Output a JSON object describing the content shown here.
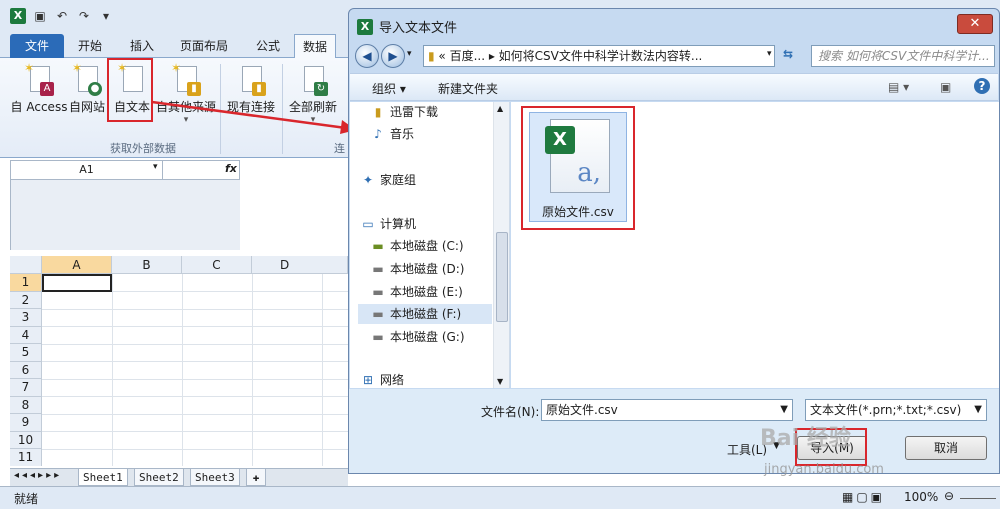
{
  "excel": {
    "qat_icons": [
      "save-icon",
      "undo-icon",
      "redo-icon"
    ],
    "tabs": [
      "文件",
      "开始",
      "插入",
      "页面布局",
      "公式",
      "数据"
    ],
    "ribbon_buttons": [
      "自 Access",
      "自网站",
      "自文本",
      "自其他来源",
      "现有连接",
      "全部刷新"
    ],
    "group_label": "获取外部数据",
    "group_label_cut": "连",
    "namebox": "A1",
    "fx": "fx",
    "columns": [
      "A",
      "B",
      "C",
      "D"
    ],
    "rows": [
      "1",
      "2",
      "3",
      "4",
      "5",
      "6",
      "7",
      "8",
      "9",
      "10",
      "11"
    ],
    "sheets": [
      "Sheet1",
      "Sheet2",
      "Sheet3"
    ],
    "status": "就绪",
    "zoom": "100%",
    "accent": "#2b6bb8"
  },
  "dialog": {
    "title": "导入文本文件",
    "close": "✕",
    "address": "« 百度... ▸ 如何将CSV文件中科学计数法内容转...",
    "search_placeholder": "搜索 如何将CSV文件中科学计...",
    "toolbar": {
      "organize": "组织 ▾",
      "new_folder": "新建文件夹"
    },
    "nav_items": [
      {
        "label": "迅雷下载",
        "icon": "folder-icon"
      },
      {
        "label": "音乐",
        "icon": "music-icon"
      },
      {
        "label": "家庭组",
        "icon": "homegroup-icon"
      },
      {
        "label": "计算机",
        "icon": "computer-icon"
      },
      {
        "label": "本地磁盘 (C:)",
        "icon": "drive-icon"
      },
      {
        "label": "本地磁盘 (D:)",
        "icon": "drive-icon"
      },
      {
        "label": "本地磁盘 (E:)",
        "icon": "drive-icon"
      },
      {
        "label": "本地磁盘 (F:)",
        "icon": "drive-icon"
      },
      {
        "label": "本地磁盘 (G:)",
        "icon": "drive-icon"
      },
      {
        "label": "网络",
        "icon": "network-icon"
      }
    ],
    "file": {
      "name": "原始文件.csv",
      "letter": "a,"
    },
    "filename_label": "文件名(N):",
    "filename_value": "原始文件.csv",
    "filetype_value": "文本文件(*.prn;*.txt;*.csv)",
    "tools_label": "工具(L)",
    "import_label": "导入(M)",
    "cancel_label": "取消",
    "highlight_color": "#d9262c"
  },
  "watermark": {
    "brand": "Bai 经验",
    "url": "jingyan.baidu.com"
  }
}
